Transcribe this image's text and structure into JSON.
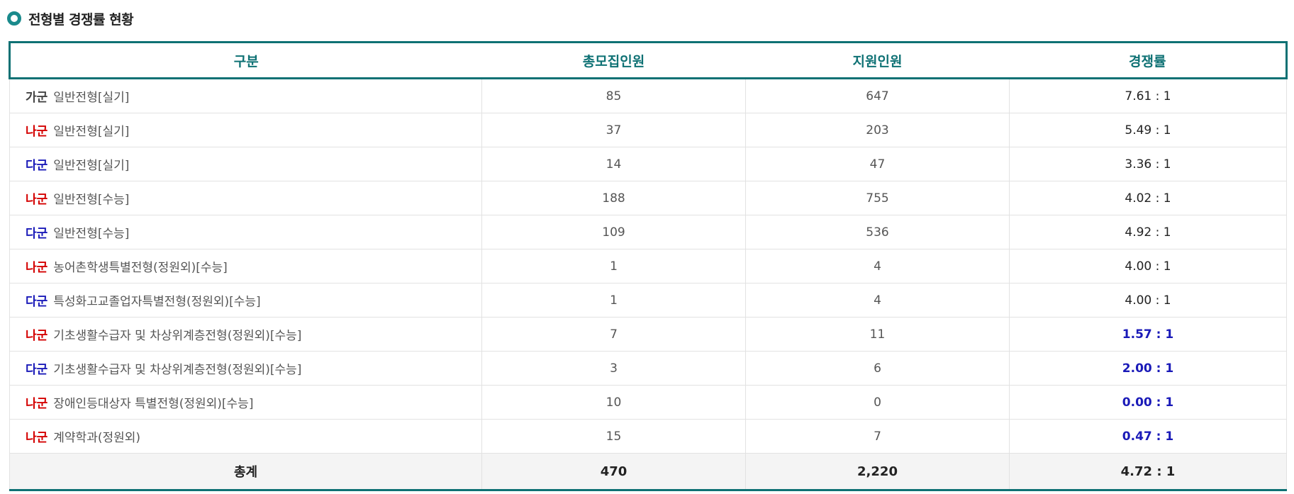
{
  "section": {
    "title": "전형별 경쟁률 현황"
  },
  "table": {
    "headers": [
      "구분",
      "총모집인원",
      "지원인원",
      "경쟁률"
    ],
    "rows": [
      {
        "group": "가군",
        "group_color": "#444444",
        "name": "일반전형[실기]",
        "quota": "85",
        "applicants": "647",
        "ratio": "7.61 : 1",
        "ratio_low": false
      },
      {
        "group": "나군",
        "group_color": "#d40000",
        "name": "일반전형[실기]",
        "quota": "37",
        "applicants": "203",
        "ratio": "5.49 : 1",
        "ratio_low": false
      },
      {
        "group": "다군",
        "group_color": "#1a1ab8",
        "name": "일반전형[실기]",
        "quota": "14",
        "applicants": "47",
        "ratio": "3.36 : 1",
        "ratio_low": false
      },
      {
        "group": "나군",
        "group_color": "#d40000",
        "name": "일반전형[수능]",
        "quota": "188",
        "applicants": "755",
        "ratio": "4.02 : 1",
        "ratio_low": false
      },
      {
        "group": "다군",
        "group_color": "#1a1ab8",
        "name": "일반전형[수능]",
        "quota": "109",
        "applicants": "536",
        "ratio": "4.92 : 1",
        "ratio_low": false
      },
      {
        "group": "나군",
        "group_color": "#d40000",
        "name": "농어촌학생특별전형(정원외)[수능]",
        "quota": "1",
        "applicants": "4",
        "ratio": "4.00 : 1",
        "ratio_low": false
      },
      {
        "group": "다군",
        "group_color": "#1a1ab8",
        "name": "특성화고교졸업자특별전형(정원외)[수능]",
        "quota": "1",
        "applicants": "4",
        "ratio": "4.00 : 1",
        "ratio_low": false
      },
      {
        "group": "나군",
        "group_color": "#d40000",
        "name": "기초생활수급자 및 차상위계층전형(정원외)[수능]",
        "quota": "7",
        "applicants": "11",
        "ratio": "1.57 : 1",
        "ratio_low": true
      },
      {
        "group": "다군",
        "group_color": "#1a1ab8",
        "name": "기초생활수급자 및 차상위계층전형(정원외)[수능]",
        "quota": "3",
        "applicants": "6",
        "ratio": "2.00 : 1",
        "ratio_low": true
      },
      {
        "group": "나군",
        "group_color": "#d40000",
        "name": "장애인등대상자 특별전형(정원외)[수능]",
        "quota": "10",
        "applicants": "0",
        "ratio": "0.00 : 1",
        "ratio_low": true
      },
      {
        "group": "나군",
        "group_color": "#d40000",
        "name": "계약학과(정원외)",
        "quota": "15",
        "applicants": "7",
        "ratio": "0.47 : 1",
        "ratio_low": true
      }
    ],
    "total": {
      "label": "총계",
      "quota": "470",
      "applicants": "2,220",
      "ratio": "4.72 : 1"
    }
  },
  "colors": {
    "accent": "#0e7174",
    "group_ga": "#444444",
    "group_na": "#d40000",
    "group_da": "#1a1ab8",
    "ratio_low": "#1a1ab8"
  }
}
